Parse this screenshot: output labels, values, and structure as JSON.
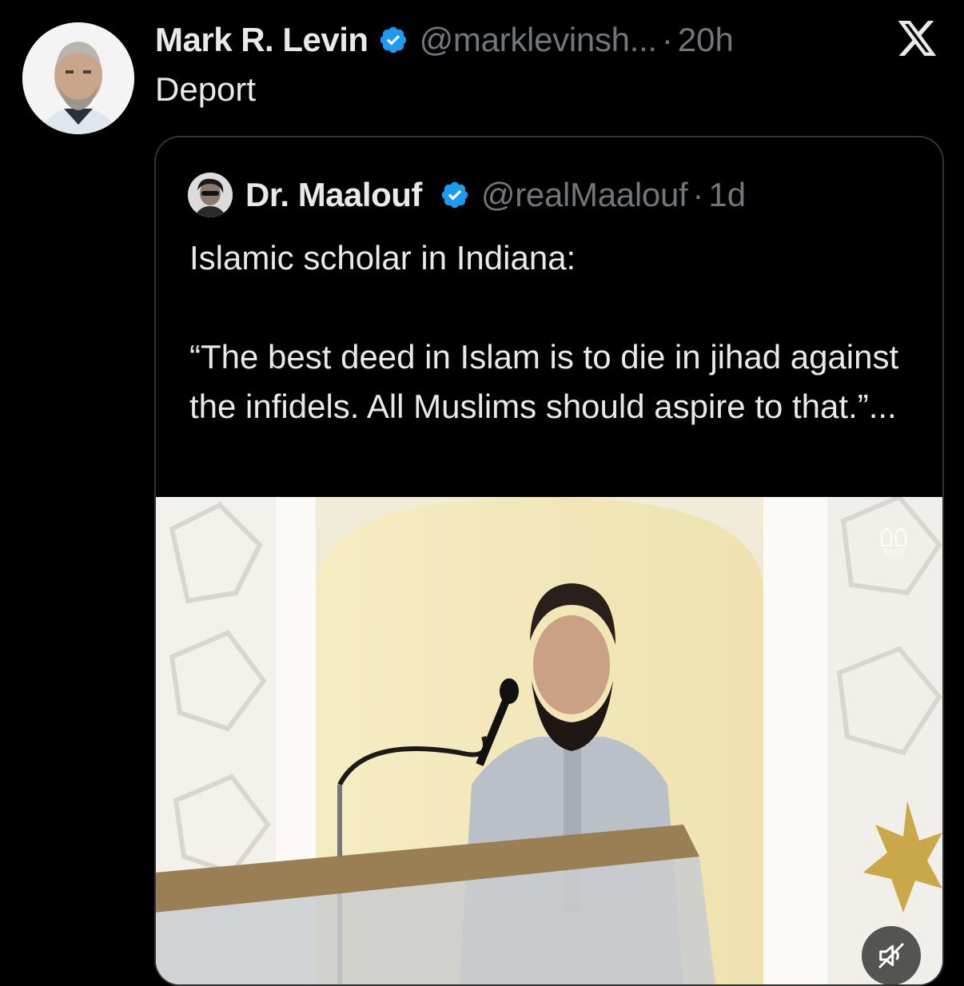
{
  "post": {
    "author_name": "Mark R. Levin",
    "handle": "@marklevinsh...",
    "separator": "·",
    "time": "20h",
    "text": "Deport"
  },
  "quoted_post": {
    "author_name": "Dr. Maalouf",
    "handle": "@realMaalouf",
    "separator": "·",
    "time": "1d",
    "text": "Islamic scholar in Indiana:\n\n“The best deed in Islam is to die in jihad against the infidels. All Muslims should aspire to that.”...",
    "media": {
      "type": "video",
      "watermark": "MCI",
      "muted": true
    }
  },
  "colors": {
    "background": "#000000",
    "text_primary": "#e7e9ea",
    "text_secondary": "#71767b",
    "verified_badge": "#1d9bf0",
    "card_border": "#2f3336"
  },
  "icons": {
    "verified": "verified-badge-icon",
    "brand": "x-logo-icon",
    "mute": "volume-muted-icon"
  }
}
